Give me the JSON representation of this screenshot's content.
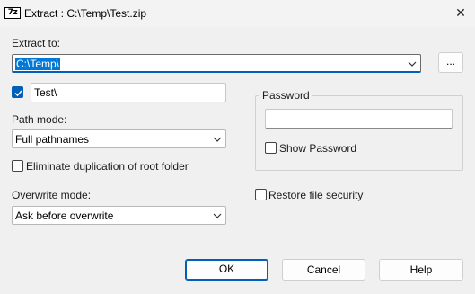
{
  "window": {
    "app_icon_text": "7z",
    "title": "Extract : C:\\Temp\\Test.zip",
    "close_glyph": "✕"
  },
  "extract_to": {
    "label": "Extract to:",
    "value": "C:\\Temp\\",
    "browse_label": "..."
  },
  "subfolder": {
    "checked": true,
    "value": "Test\\"
  },
  "path_mode": {
    "label": "Path mode:",
    "value": "Full pathnames"
  },
  "eliminate_dup": {
    "label": "Eliminate duplication of root folder",
    "checked": false
  },
  "overwrite_mode": {
    "label": "Overwrite mode:",
    "value": "Ask before overwrite"
  },
  "password": {
    "group_label": "Password",
    "value": "",
    "show_label": "Show Password",
    "show_checked": false
  },
  "restore_security": {
    "label": "Restore file security",
    "checked": false
  },
  "buttons": {
    "ok": "OK",
    "cancel": "Cancel",
    "help": "Help"
  },
  "colors": {
    "accent": "#005fb8",
    "selection": "#0078d7",
    "dialog_bg": "#f0f0f0"
  }
}
